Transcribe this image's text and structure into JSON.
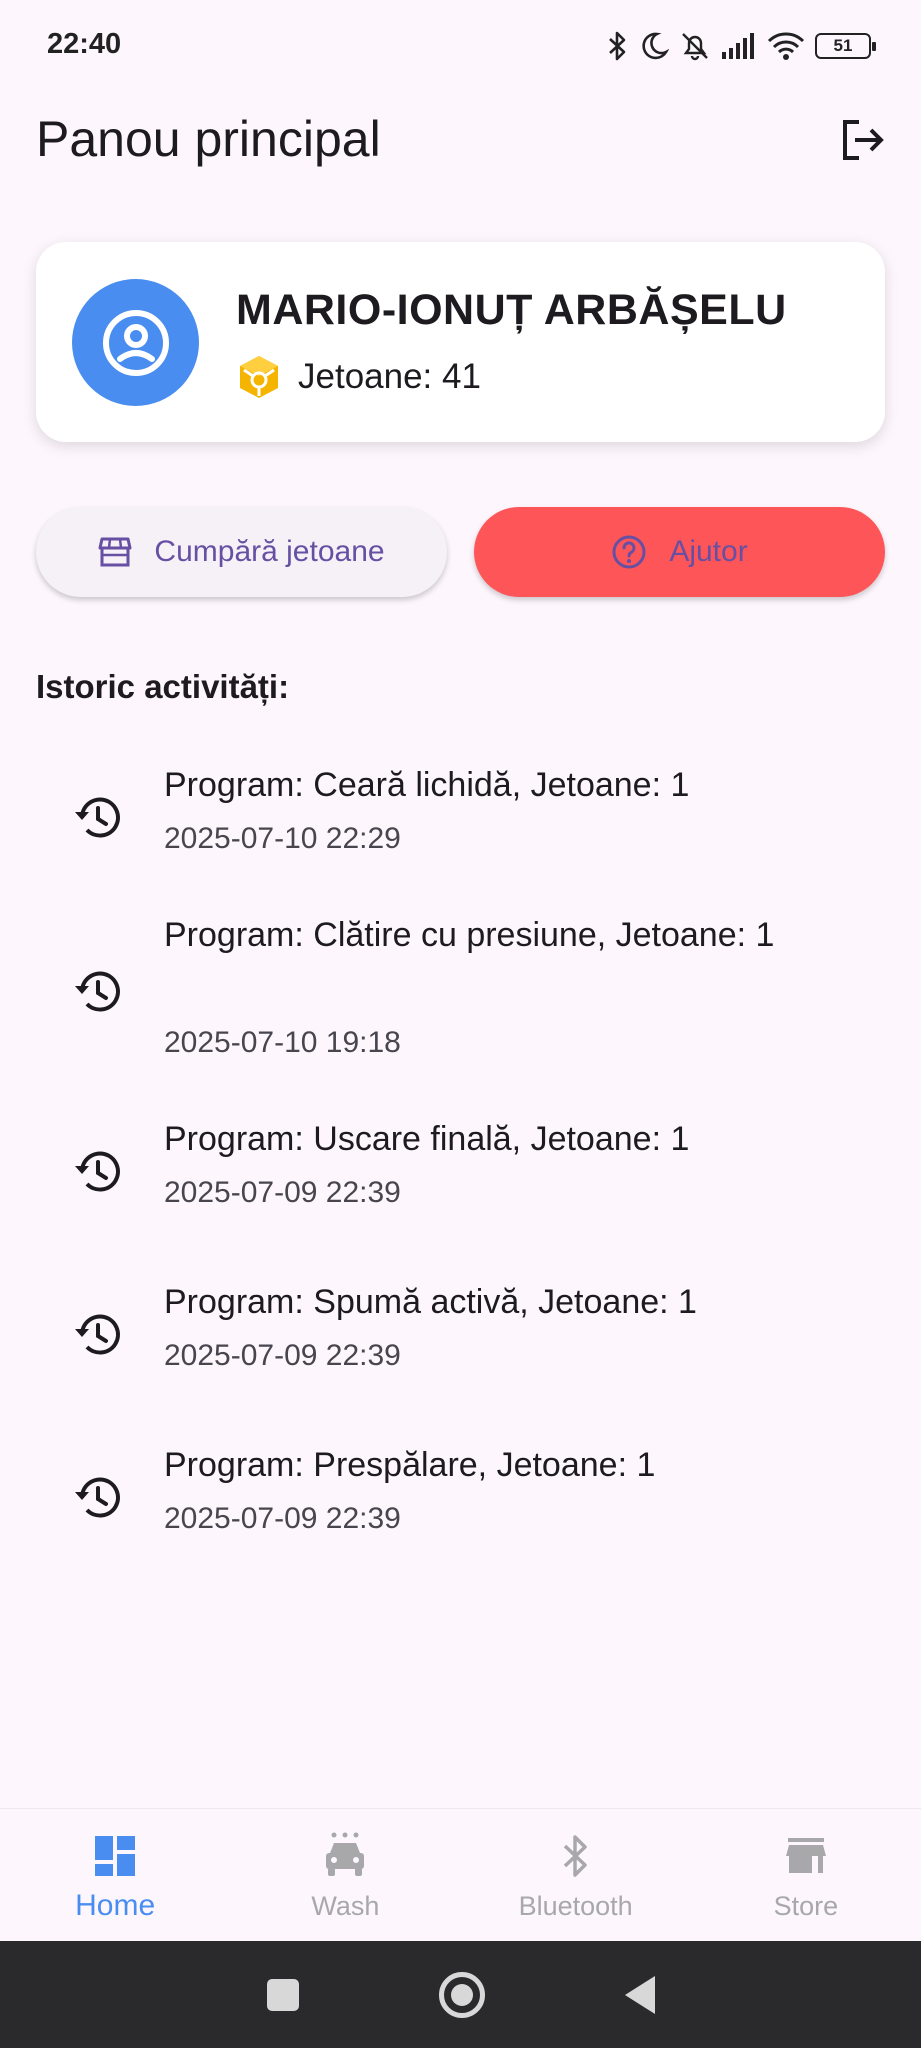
{
  "status_bar": {
    "time": "22:40",
    "battery": "51"
  },
  "app_bar": {
    "title": "Panou principal"
  },
  "profile": {
    "name": "MARIO-IONUȚ ARBĂȘELU",
    "tokens_label": "Jetoane: 41"
  },
  "actions": {
    "buy_label": "Cumpără jetoane",
    "help_label": "Ajutor"
  },
  "history": {
    "title": "Istoric activități:",
    "items": [
      {
        "text": "Program: Ceară lichidă, Jetoane: 1",
        "date": "2025-07-10 22:29"
      },
      {
        "text": "Program: Clătire cu presiune, Jetoane: 1",
        "date": "2025-07-10 19:18"
      },
      {
        "text": "Program: Uscare finală, Jetoane: 1",
        "date": "2025-07-09 22:39"
      },
      {
        "text": "Program: Spumă activă, Jetoane: 1",
        "date": "2025-07-09 22:39"
      },
      {
        "text": "Program: Prespălare, Jetoane: 1",
        "date": "2025-07-09 22:39"
      }
    ]
  },
  "bottom_nav": {
    "items": [
      {
        "label": "Home",
        "icon": "dashboard-icon",
        "active": true
      },
      {
        "label": "Wash",
        "icon": "car-wash-icon",
        "active": false
      },
      {
        "label": "Bluetooth",
        "icon": "bluetooth-icon",
        "active": false
      },
      {
        "label": "Store",
        "icon": "store-icon",
        "active": false
      }
    ]
  },
  "colors": {
    "background": "#fdf7fd",
    "accent_blue": "#4a8df0",
    "help_red": "#fd5558",
    "button_text_purple": "#6750a4",
    "token_yellow": "#f5b400"
  }
}
